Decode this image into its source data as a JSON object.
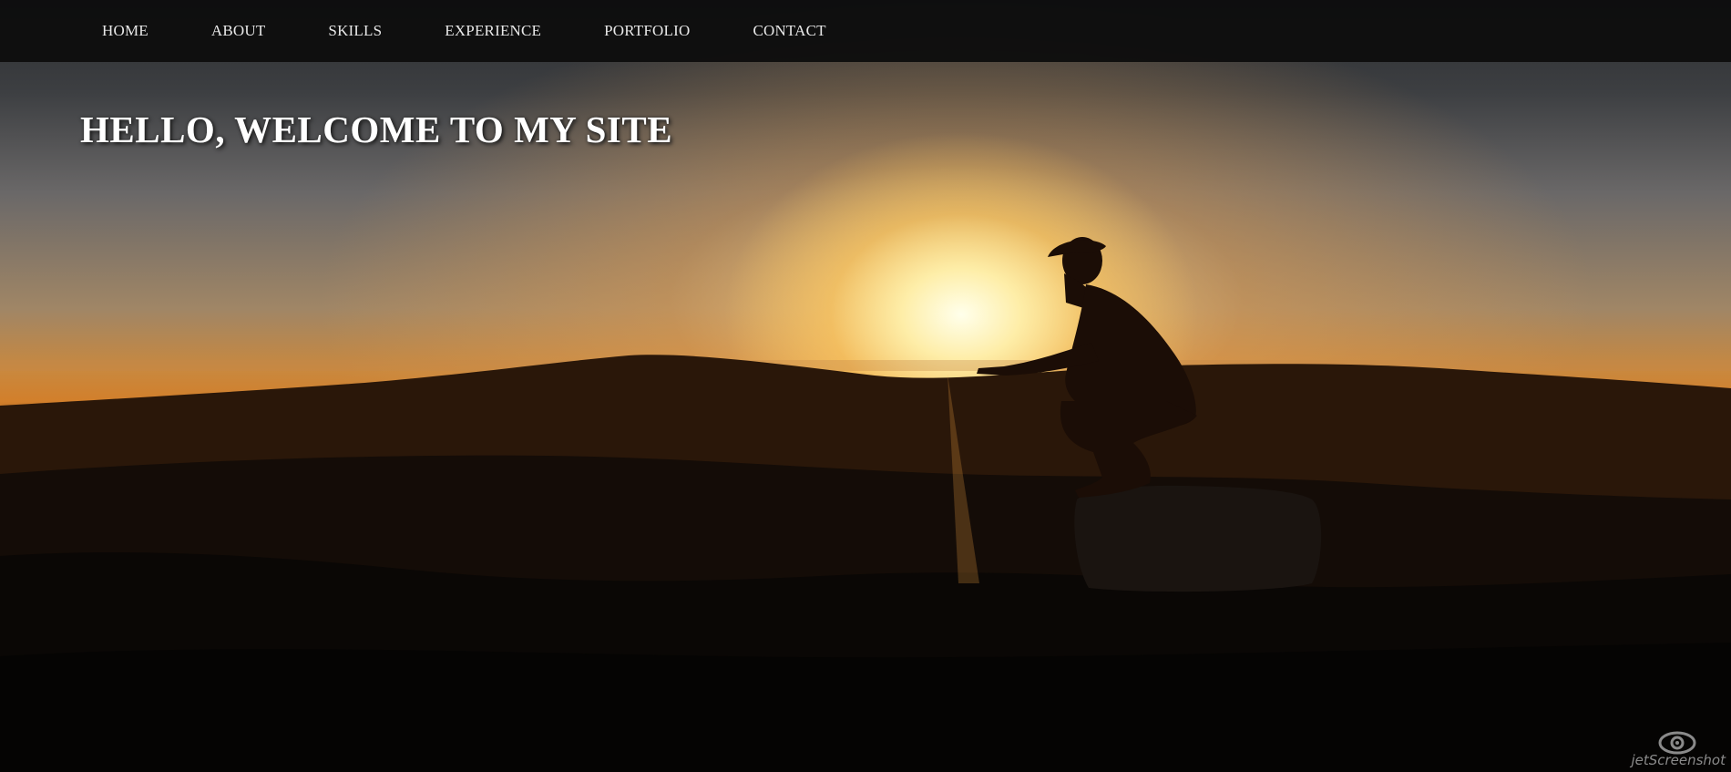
{
  "nav": {
    "items": [
      {
        "label": "HOME"
      },
      {
        "label": "ABOUT"
      },
      {
        "label": "SKILLS"
      },
      {
        "label": "EXPERIENCE"
      },
      {
        "label": "PORTFOLIO"
      },
      {
        "label": "CONTACT"
      }
    ]
  },
  "hero": {
    "title": "HELLO, WELCOME TO MY SITE",
    "background_image": "sunset-silhouette-person-crouching-on-rock"
  },
  "watermark": {
    "text": "jetScreenshot",
    "icon": "eye-camera-icon"
  },
  "colors": {
    "nav_background": "#0e0e0e",
    "nav_text": "#e8e8e8",
    "title_text": "#ffffff",
    "sun": "#fff6d8",
    "sky_orange": "#d27f2b"
  }
}
